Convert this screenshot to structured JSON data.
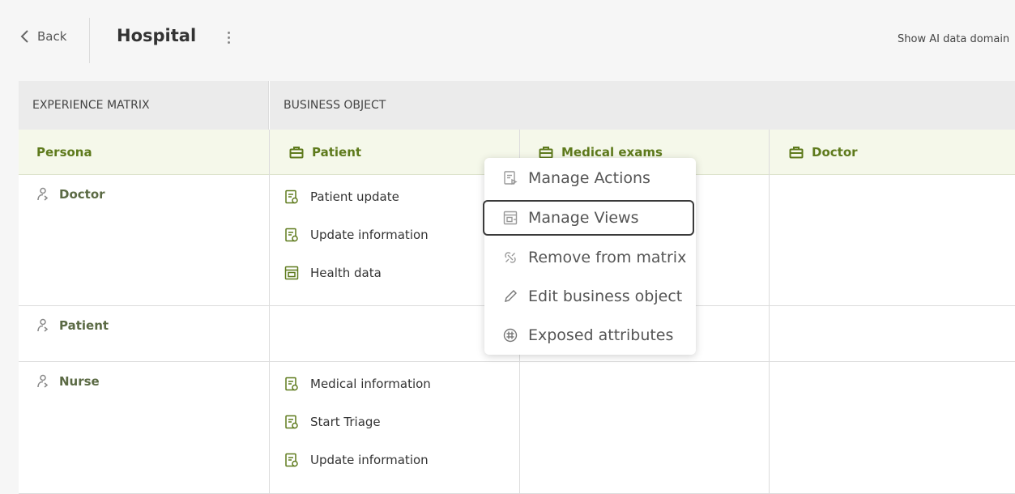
{
  "header": {
    "back_label": "Back",
    "title": "Hospital",
    "show_ai_label": "Show AI data domain"
  },
  "matrix": {
    "experience_header": "EXPERIENCE MATRIX",
    "business_object_header": "BUSINESS OBJECT",
    "persona_column_label": "Persona",
    "objects": [
      "Patient",
      "Medical exams",
      "Doctor"
    ],
    "rows": [
      {
        "persona": "Doctor",
        "patient_items": [
          "Patient update",
          "Update information",
          "Health data"
        ]
      },
      {
        "persona": "Patient",
        "patient_items": []
      },
      {
        "persona": "Nurse",
        "patient_items": [
          "Medical information",
          "Start Triage",
          "Update information"
        ]
      }
    ]
  },
  "context_menu": {
    "items": [
      "Manage Actions",
      "Manage Views",
      "Remove from matrix",
      "Edit business object",
      "Exposed attributes"
    ],
    "highlighted": "Manage Views"
  },
  "colors": {
    "accent_green": "#5e7a1c",
    "header_bg": "#ebebeb",
    "object_row_bg": "#f5f8ea"
  }
}
